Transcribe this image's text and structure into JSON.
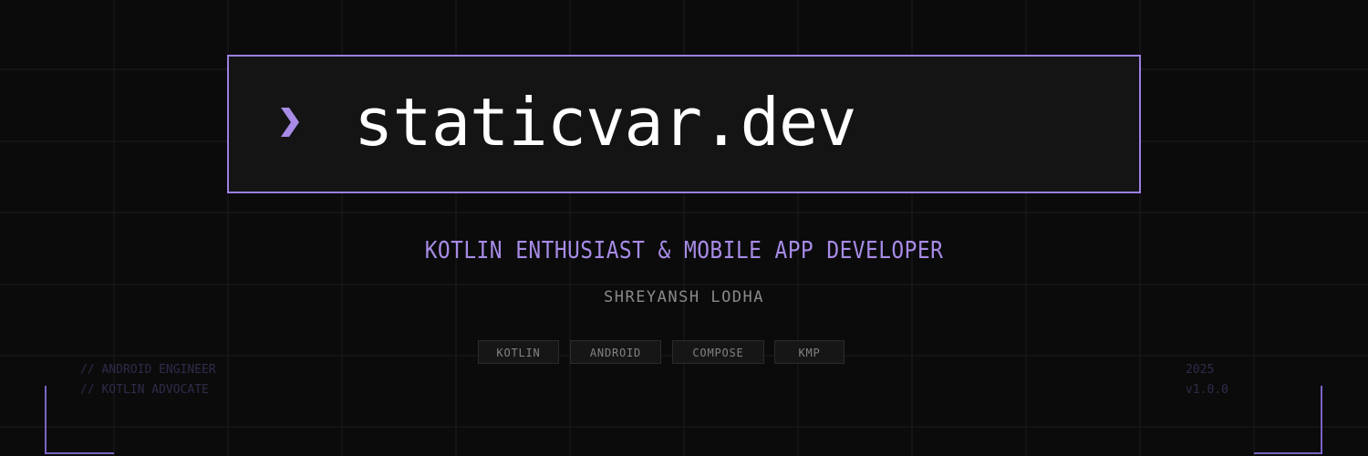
{
  "domain": {
    "prompt_icon": "chevron-right-icon",
    "text": "staticvar.dev"
  },
  "tagline": "KOTLIN ENTHUSIAST & MOBILE APP DEVELOPER",
  "author": "SHREYANSH LODHA",
  "tags": [
    "KOTLIN",
    "ANDROID",
    "COMPOSE",
    "KMP"
  ],
  "comments_left": [
    "// ANDROID ENGINEER",
    "// KOTLIN ADVOCATE"
  ],
  "comments_right": [
    "2025",
    "v1.0.0"
  ],
  "colors": {
    "background": "#0b0b0b",
    "accent": "#a78be6",
    "box_border": "#9b80e0",
    "box_fill": "#141414",
    "grid_line": "#1c1c1c",
    "comment": "#2f2b4a"
  }
}
